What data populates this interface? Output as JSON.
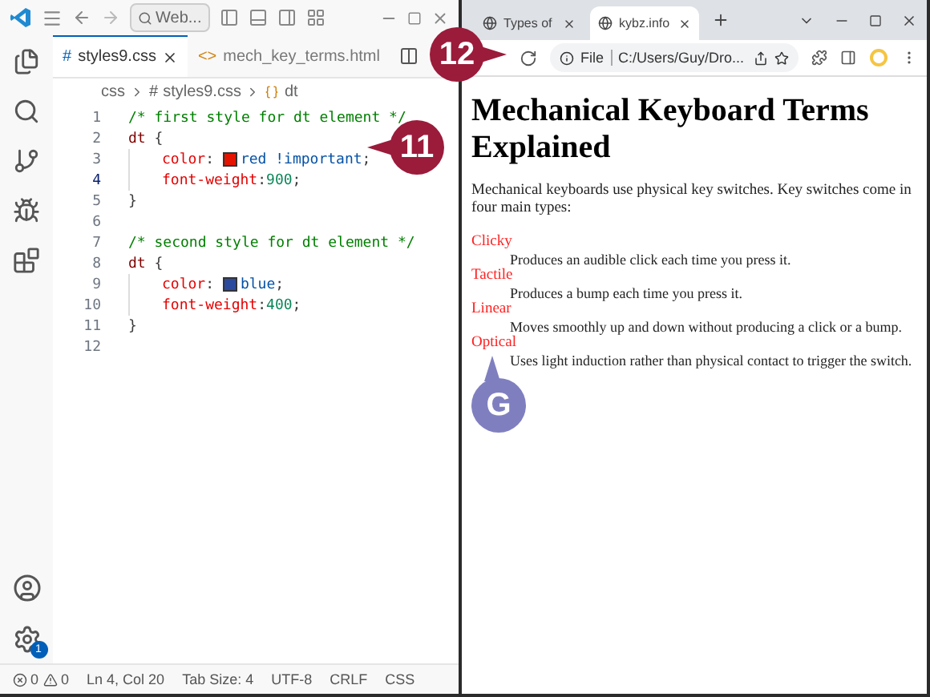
{
  "editor": {
    "search": "Web...",
    "tabs": [
      {
        "label": "styles9.css",
        "icon": "#",
        "selected": true
      },
      {
        "label": "mech_key_terms.html",
        "icon": "<>",
        "selected": false
      }
    ],
    "breadcrumb": [
      "css",
      "styles9.css",
      "dt"
    ],
    "lines": [
      {
        "number": "1",
        "current": false,
        "tokens": [
          {
            "kind": "comment",
            "text": "/* first style for dt element */"
          }
        ]
      },
      {
        "number": "2",
        "current": false,
        "tokens": [
          {
            "kind": "selector",
            "text": "dt"
          },
          {
            "kind": "brace",
            "text": " {"
          }
        ]
      },
      {
        "number": "3",
        "current": false,
        "tokens": [
          {
            "kind": "indent"
          },
          {
            "kind": "property",
            "text": "color"
          },
          {
            "kind": "plain",
            "text": ": "
          },
          {
            "kind": "swatch",
            "color": "#e51400"
          },
          {
            "kind": "value",
            "text": "red !important"
          },
          {
            "kind": "plain",
            "text": ";"
          }
        ]
      },
      {
        "number": "4",
        "current": true,
        "tokens": [
          {
            "kind": "indent"
          },
          {
            "kind": "property",
            "text": "font-weight"
          },
          {
            "kind": "plain",
            "text": ":"
          },
          {
            "kind": "number",
            "text": "900"
          },
          {
            "kind": "plain",
            "text": ";"
          }
        ]
      },
      {
        "number": "5",
        "current": false,
        "tokens": [
          {
            "kind": "brace",
            "text": "}"
          }
        ]
      },
      {
        "number": "6",
        "current": false
      },
      {
        "number": "7",
        "current": false,
        "tokens": [
          {
            "kind": "comment",
            "text": "/* second style for dt element */"
          }
        ]
      },
      {
        "number": "8",
        "current": false,
        "tokens": [
          {
            "kind": "selector",
            "text": "dt"
          },
          {
            "kind": "brace",
            "text": " {"
          }
        ]
      },
      {
        "number": "9",
        "current": false,
        "tokens": [
          {
            "kind": "indent"
          },
          {
            "kind": "property",
            "text": "color"
          },
          {
            "kind": "plain",
            "text": ": "
          },
          {
            "kind": "swatch",
            "color": "#2b4a9e"
          },
          {
            "kind": "value",
            "text": "blue"
          },
          {
            "kind": "plain",
            "text": ";"
          }
        ]
      },
      {
        "number": "10",
        "current": false,
        "tokens": [
          {
            "kind": "indent"
          },
          {
            "kind": "property",
            "text": "font-weight"
          },
          {
            "kind": "plain",
            "text": ":"
          },
          {
            "kind": "number",
            "text": "400"
          },
          {
            "kind": "plain",
            "text": ";"
          }
        ]
      },
      {
        "number": "11",
        "current": false,
        "tokens": [
          {
            "kind": "brace",
            "text": "}"
          }
        ]
      },
      {
        "number": "12",
        "current": false
      }
    ],
    "settings_badge": "1",
    "status": {
      "errors": "0",
      "warnings": "0",
      "items": [
        "Ln 4, Col 20",
        "Tab Size: 4",
        "UTF-8",
        "CRLF",
        "CSS"
      ]
    }
  },
  "browser": {
    "tabs": [
      {
        "label": "Types of",
        "selected": false
      },
      {
        "label": "kybz.info",
        "selected": true
      }
    ],
    "address_scheme": "File",
    "address": "C:/Users/Guy/Dro...",
    "heading": "Mechanical Keyboard Terms Explained",
    "intro": "Mechanical keyboards use physical key switches. Key switches come in four main types:",
    "terms": [
      {
        "term": "Clicky",
        "definition": "Produces an audible click each time you press it."
      },
      {
        "term": "Tactile",
        "definition": "Produces a bump each time you press it."
      },
      {
        "term": "Linear",
        "definition": "Moves smoothly up and down without producing a click or a bump."
      },
      {
        "term": "Optical",
        "definition": "Uses light induction rather than physical contact to trigger the switch."
      }
    ]
  },
  "callouts": [
    {
      "text": "11",
      "kind": "step"
    },
    {
      "text": "12",
      "kind": "step"
    },
    {
      "text": "G",
      "kind": "letter"
    }
  ]
}
